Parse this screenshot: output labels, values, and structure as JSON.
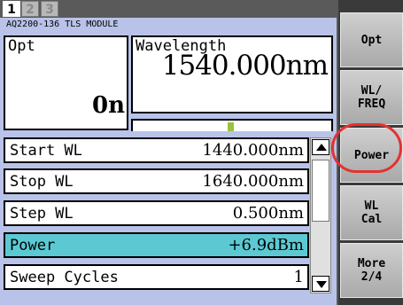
{
  "tabs": [
    {
      "label": "1",
      "active": true
    },
    {
      "label": "2",
      "active": false
    },
    {
      "label": "3",
      "active": false
    }
  ],
  "module_title": "AQ2200-136 TLS MODULE",
  "opt_box": {
    "label": "Opt",
    "value": "0n"
  },
  "wavelength_box": {
    "label": "Wavelength",
    "value": "1540.000nm"
  },
  "params": [
    {
      "name": "Start WL",
      "value": "1440.000nm",
      "selected": false
    },
    {
      "name": "Stop WL",
      "value": "1640.000nm",
      "selected": false
    },
    {
      "name": "Step WL",
      "value": "0.500nm",
      "selected": false
    },
    {
      "name": "Power",
      "value": "+6.9dBm",
      "selected": true
    },
    {
      "name": "Sweep Cycles",
      "value": "1",
      "selected": false
    }
  ],
  "softkeys": [
    {
      "label": "Opt"
    },
    {
      "label": "WL/\nFREQ"
    },
    {
      "label": "Power"
    },
    {
      "label": "WL\nCal"
    },
    {
      "label": "More\n2/4"
    }
  ],
  "colors": {
    "panel": "#b9c3e9",
    "selected_row": "#5cc9d2",
    "highlight_ring": "#e23232"
  }
}
